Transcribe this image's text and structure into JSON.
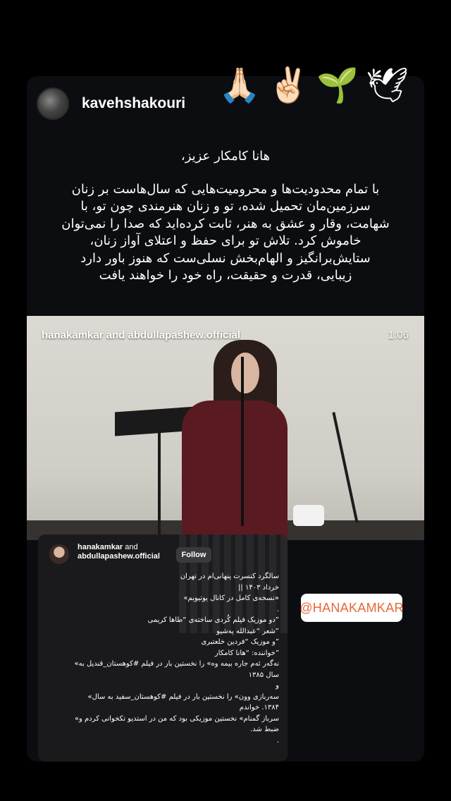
{
  "story": {
    "username": "kavehshakouri",
    "emojis": [
      "🙏🏻",
      "✌🏻",
      "🌱",
      "🕊"
    ],
    "caption_greeting": "هانا کامکار عزیز،",
    "caption_lines": [
      "با تمام محدودیت‌ها و محرومیت‌هایی که سال‌هاست بر زنان",
      "سرزمین‌مان تحمیل شده، تو و زنان هنرمندی چون تو، با",
      "شهامت، وقار و عشق به هنر، ثابت کرده‌اید که صدا را نمی‌توان",
      "خاموش کرد. تلاش تو برای حفظ و اعتلای آواز زنان،",
      "ستایش‌برانگیز و الهام‌بخش نسلی‌ست که هنوز باور دارد",
      "زیبایی، قدرت و حقیقت، راه خود را خواهند یافت"
    ]
  },
  "video": {
    "users": "hanakamkar and abdullapashew.official",
    "duration": "1:06"
  },
  "post": {
    "user_line1": "hanakamkar",
    "user_line1_suffix": " and",
    "user_line2": "abdullapashew.official",
    "follow_label": "Follow",
    "caption_lines": [
      "سالگرد کنسرت پنهانی‌ام در تهران",
      "خرداد ۱۴۰۳ ||",
      "«نسخه‌ی کامل در کانال یوتیوبم»",
      ".",
      "”دو موزیک فیلم کُردی ساخته‌ی “طاها کریمی",
      "”شعر “عبدالله پەشیو",
      "”و موزیک “فردین خلعتبری",
      "”خواننده: “هانا کامکار",
      "نەگەر ئەم جارە بیمە وە» را نخستین بار در فیلم #کوهستان_قندیل به»",
      "سال ۱۳۸۵",
      "و",
      "سەربازی وون» را نخستین بار در فیلم #کوهستان_سفید به سال»",
      "۱۳۸۴. خواندم",
      "سرباز گمنام» نخستین موزیکی بود که من در استدیو تکخوانی کردم و»",
      "ضبط شد.",
      "."
    ]
  },
  "mention_sticker": "@HANAKAMKAR",
  "colors": {
    "background": "#000000",
    "card": "#0c0d11",
    "mention_text": "#e4683a"
  }
}
